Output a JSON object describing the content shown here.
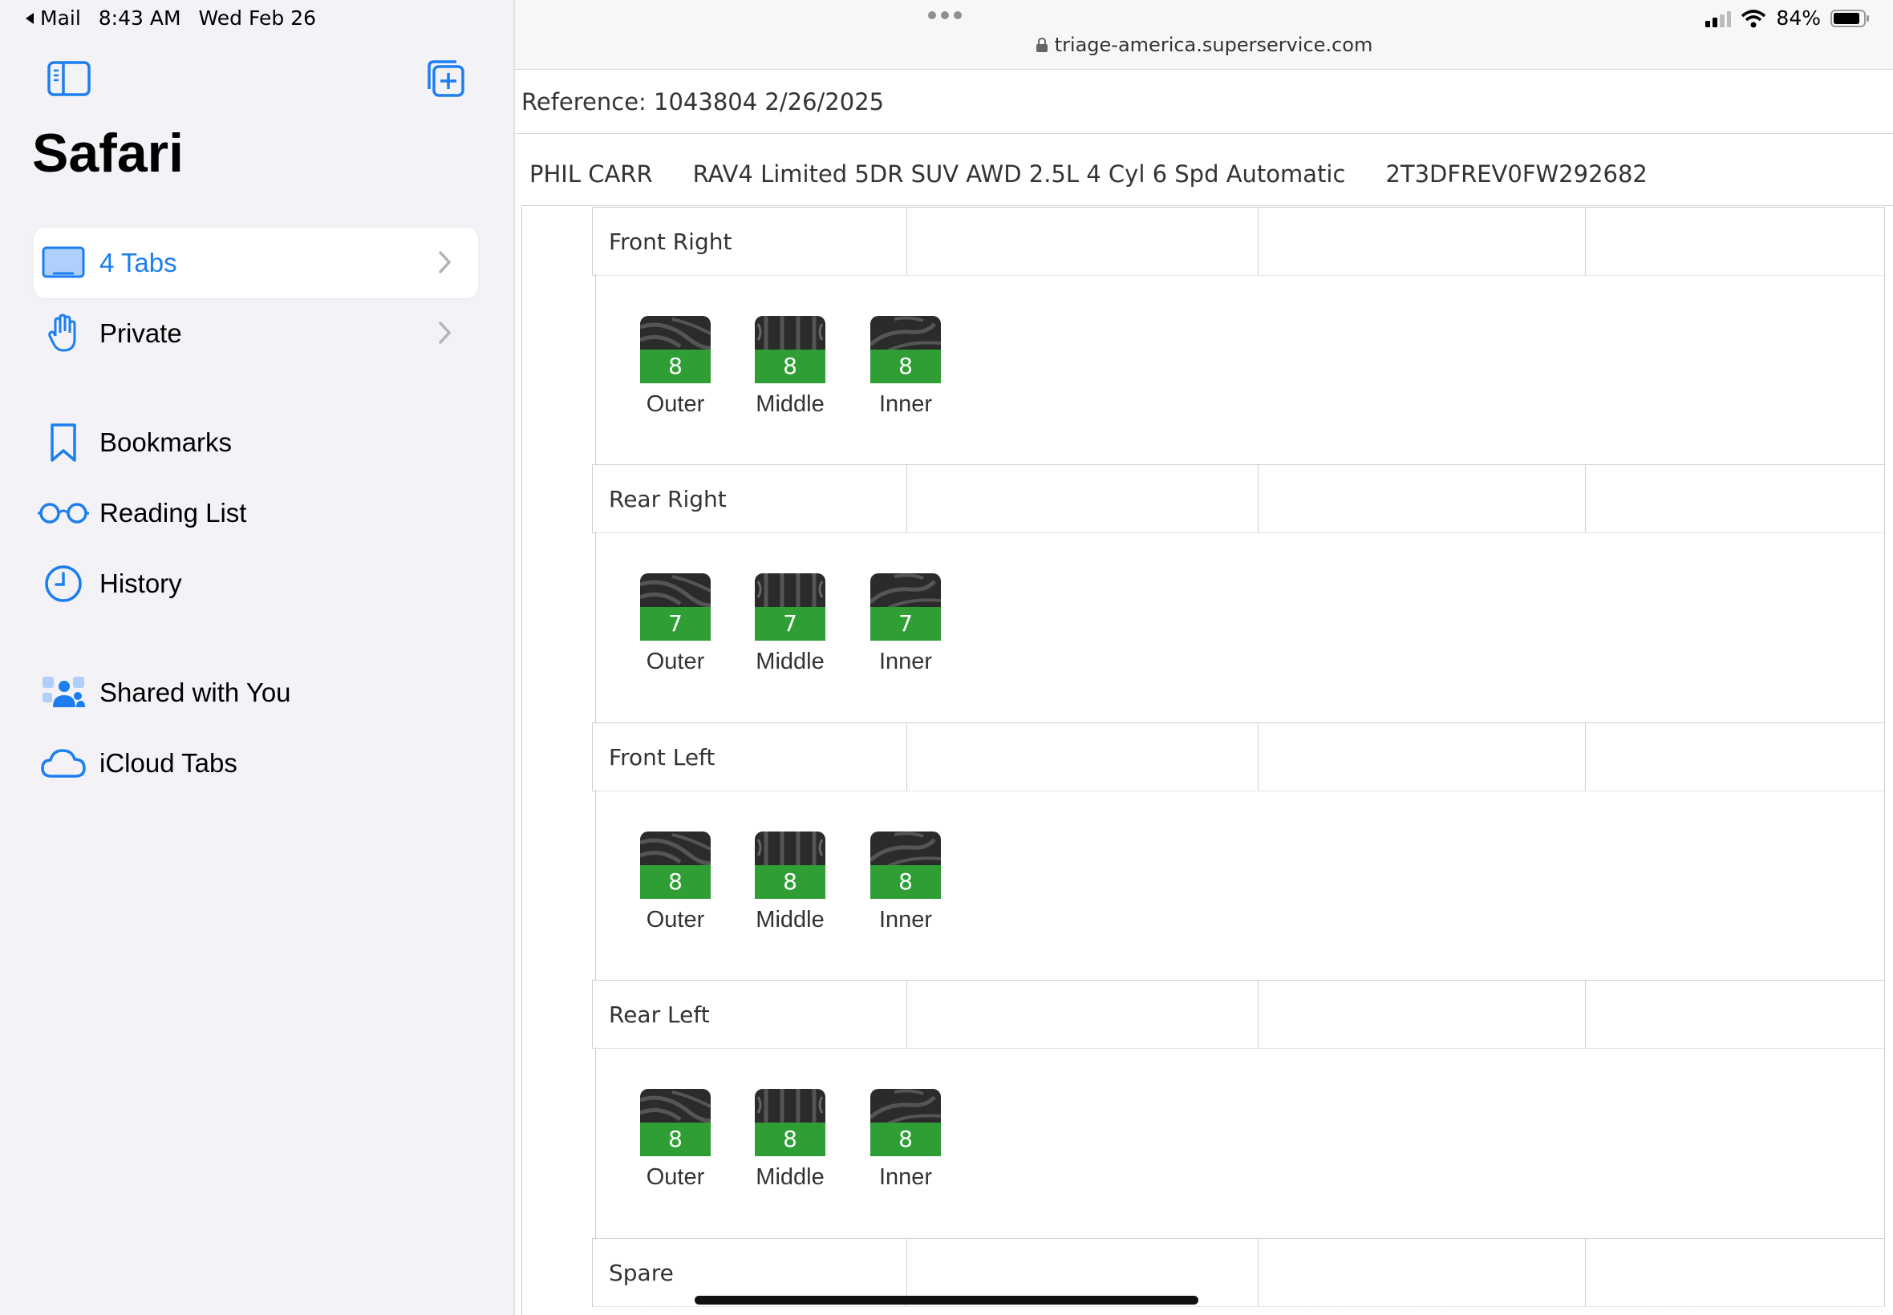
{
  "status_bar": {
    "back_app": "Mail",
    "time": "8:43 AM",
    "date": "Wed Feb 26",
    "battery": "84%"
  },
  "sidebar": {
    "title": "Safari",
    "items": [
      {
        "label": "4 Tabs",
        "icon": "tabs-icon"
      },
      {
        "label": "Private",
        "icon": "hand-icon"
      },
      {
        "label": "Bookmarks",
        "icon": "bookmark-icon"
      },
      {
        "label": "Reading List",
        "icon": "glasses-icon"
      },
      {
        "label": "History",
        "icon": "clock-icon"
      },
      {
        "label": "Shared with You",
        "icon": "shared-people-icon"
      },
      {
        "label": "iCloud Tabs",
        "icon": "cloud-icon"
      }
    ]
  },
  "browser": {
    "url": "triage-america.superservice.com"
  },
  "page": {
    "reference": "Reference: 1043804 2/26/2025",
    "vehicle": {
      "customer": "PHIL CARR",
      "description": "RAV4 Limited 5DR SUV AWD 2.5L 4 Cyl 6 Spd Automatic",
      "vin": "2T3DFREV0FW292682"
    },
    "tire_labels": [
      "Outer",
      "Middle",
      "Inner"
    ],
    "positions": [
      {
        "name": "Front Right",
        "depths": [
          "8",
          "8",
          "8"
        ]
      },
      {
        "name": "Rear Right",
        "depths": [
          "7",
          "7",
          "7"
        ]
      },
      {
        "name": "Front Left",
        "depths": [
          "8",
          "8",
          "8"
        ]
      },
      {
        "name": "Rear Left",
        "depths": [
          "8",
          "8",
          "8"
        ]
      },
      {
        "name": "Spare",
        "depths": []
      }
    ]
  },
  "colors": {
    "accent": "#1c7ef0",
    "depth_good": "#2e9e35",
    "sidebar_bg": "#f2f2f7"
  }
}
